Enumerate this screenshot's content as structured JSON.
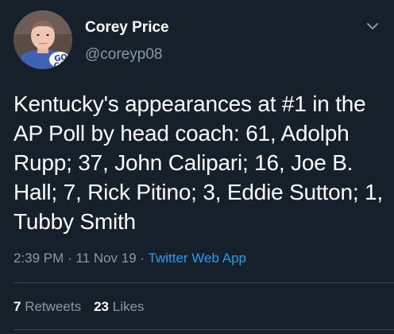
{
  "author": {
    "display_name": "Corey Price",
    "handle": "@coreyp08",
    "avatar_badge_line1": "GO",
    "avatar_badge_line2": "CAT"
  },
  "tweet": {
    "text": "Kentucky's appearances at #1 in the AP Poll by head coach: 61, Adolph Rupp; 37, John Calipari; 16, Joe B. Hall; 7, Rick Pitino; 3, Eddie Sutton; 1, Tubby Smith",
    "time": "2:39 PM",
    "separator": "·",
    "date": "11 Nov 19",
    "source": "Twitter Web App"
  },
  "stats": {
    "retweets_count": "7",
    "retweets_label": "Retweets",
    "likes_count": "23",
    "likes_label": "Likes"
  },
  "colors": {
    "background": "#15202b",
    "text_primary": "#ffffff",
    "text_secondary": "#8899a6",
    "link": "#1da1f2",
    "divider": "#38444d"
  },
  "icons": {
    "menu": "chevron-down-icon"
  }
}
